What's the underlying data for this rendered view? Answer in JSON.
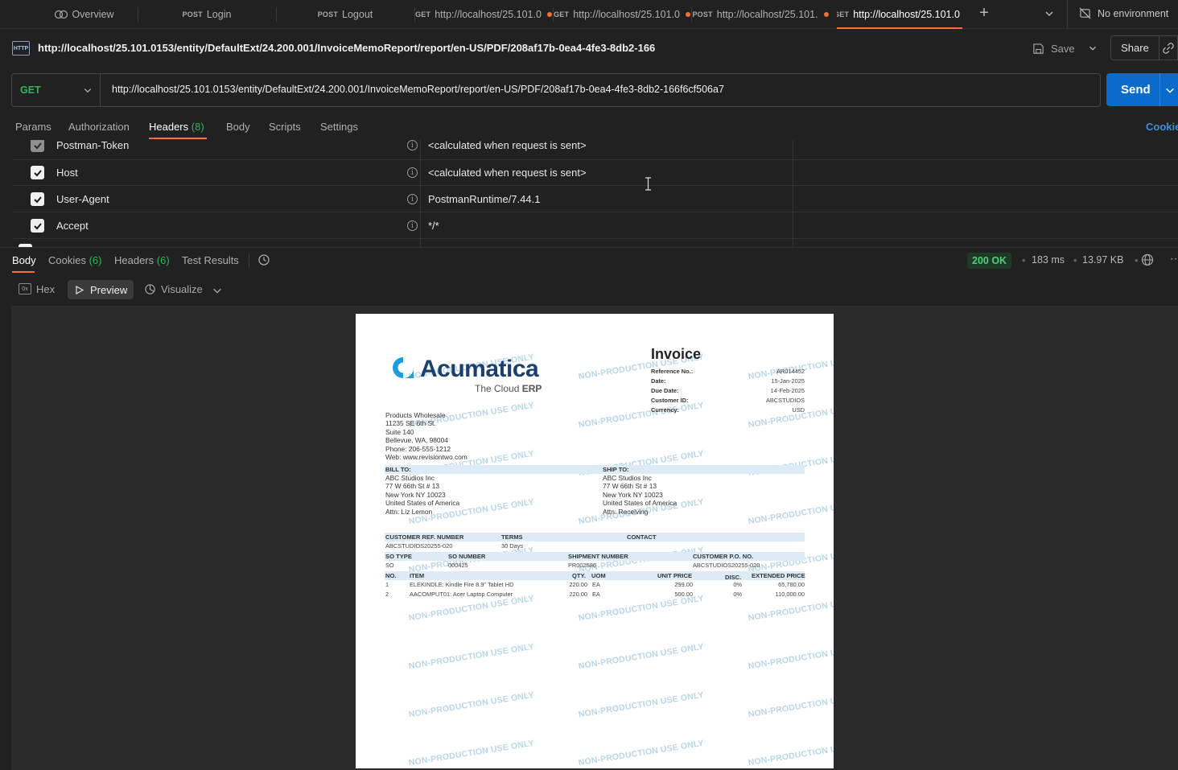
{
  "tabs": [
    {
      "method": "",
      "label": "Overview"
    },
    {
      "method": "POST",
      "label": "Login"
    },
    {
      "method": "POST",
      "label": "Logout"
    },
    {
      "method": "GET",
      "label": "http://localhost/25.101.0"
    },
    {
      "method": "GET",
      "label": "http://localhost/25.101.0"
    },
    {
      "method": "POST",
      "label": "http://localhost/25.101."
    },
    {
      "method": "GET",
      "label": "http://localhost/25.101.0"
    }
  ],
  "environment": "No environment",
  "request": {
    "title_url": "http://localhost/25.101.0153/entity/DefaultExt/24.200.001/InvoiceMemoReport/report/en-US/PDF/208af17b-0ea4-4fe3-8db2-166",
    "method": "GET",
    "url": "http://localhost/25.101.0153/entity/DefaultExt/24.200.001/InvoiceMemoReport/report/en-US/PDF/208af17b-0ea4-4fe3-8db2-166f6cf506a7",
    "save": "Save",
    "share": "Share",
    "send": "Send"
  },
  "request_tabs": {
    "params": "Params",
    "authorization": "Authorization",
    "headers": "Headers",
    "headers_count": "(8)",
    "body": "Body",
    "scripts": "Scripts",
    "settings": "Settings",
    "cookies": "Cookie"
  },
  "headers": [
    {
      "key": "Postman-Token",
      "value": "<calculated when request is sent>"
    },
    {
      "key": "Host",
      "value": "<calculated when request is sent>"
    },
    {
      "key": "User-Agent",
      "value": "PostmanRuntime/7.44.1"
    },
    {
      "key": "Accept",
      "value": "*/*"
    }
  ],
  "response_tabs": {
    "body": "Body",
    "cookies": "Cookies",
    "cookies_count": "(6)",
    "headers": "Headers",
    "headers_count": "(6)",
    "test_results": "Test Results"
  },
  "response_status": {
    "status": "200 OK",
    "time": "183 ms",
    "size": "13.97 KB"
  },
  "view_modes": {
    "hex": "Hex",
    "preview": "Preview",
    "visualize": "Visualize"
  },
  "invoice": {
    "brand": "Acumatica",
    "tagline_a": "The Cloud",
    "tagline_b": "ERP",
    "title": "Invoice",
    "meta": [
      {
        "label": "Reference No.:",
        "value": "AR014452"
      },
      {
        "label": "Date:",
        "value": "15-Jan-2025"
      },
      {
        "label": "Due Date:",
        "value": "14-Feb-2025"
      },
      {
        "label": "Customer ID:",
        "value": "ABCSTUDIOS"
      },
      {
        "label": "Currency:",
        "value": "USD"
      }
    ],
    "company": [
      "Products Wholesale",
      "11235 SE 6th St.",
      "Suite 140",
      "Bellevue, WA, 98004",
      "Phone: 206-555-1212",
      "Web: www.revisiontwo.com"
    ],
    "bill_to_label": "BILL TO:",
    "bill_to": [
      "ABC Studios Inc",
      "77 W 66th St # 13",
      "New York NY 10023",
      "United States of America",
      "Attn: Liz Lemon"
    ],
    "ship_to_label": "SHIP TO:",
    "ship_to": [
      "ABC Studios Inc",
      "77 W 66th St # 13",
      "New York NY 10023",
      "United States of America",
      "Attn: Receiving"
    ],
    "ref_headers": {
      "ref": "CUSTOMER REF. NUMBER",
      "terms": "TERMS",
      "contact": "CONTACT"
    },
    "ref_values": {
      "ref": "ABCSTUDIOS20255-020",
      "terms": "30 Days"
    },
    "so_headers": {
      "type": "SO TYPE",
      "number": "SO NUMBER",
      "shipment": "SHIPMENT NUMBER",
      "po": "CUSTOMER P.O. NO."
    },
    "so_values": {
      "type": "SO",
      "number": "000425",
      "shipment": "PR002586",
      "po": "ABCSTUDIOS20255-020"
    },
    "line_headers": {
      "no": "NO.",
      "item": "ITEM",
      "qty": "QTY.",
      "uom": "UOM",
      "price": "UNIT PRICE",
      "disc": "DISC.",
      "ext": "EXTENDED PRICE"
    },
    "lines": [
      {
        "no": "1",
        "item": "ELEKINDLE: Kindle Fire 8.9\" Tablet HD",
        "qty": "220.00",
        "uom": "EA",
        "price": "299.00",
        "disc": "0%",
        "ext": "65,780.00"
      },
      {
        "no": "2",
        "item": "AACOMPUT01: Acer Laptop Computer",
        "qty": "220.00",
        "uom": "EA",
        "price": "500.00",
        "disc": "0%",
        "ext": "110,000.00"
      }
    ],
    "watermark": "NON-PRODUCTION USE ONLY"
  }
}
